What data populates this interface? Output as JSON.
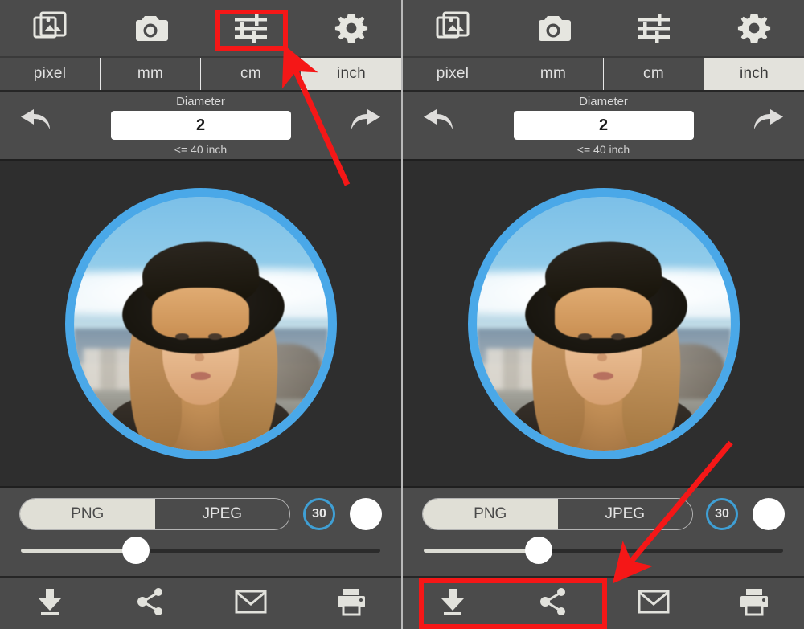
{
  "app": {
    "panels": [
      {
        "id": "left-panel",
        "toolbar": {
          "items": [
            {
              "name": "gallery-icon",
              "label": "Gallery"
            },
            {
              "name": "camera-icon",
              "label": "Camera"
            },
            {
              "name": "adjust-sliders-icon",
              "label": "Adjust"
            },
            {
              "name": "settings-gear-icon",
              "label": "Settings"
            }
          ]
        },
        "unit_tabs": [
          {
            "label": "pixel",
            "active": false
          },
          {
            "label": "mm",
            "active": false
          },
          {
            "label": "cm",
            "active": false
          },
          {
            "label": "inch",
            "active": true
          }
        ],
        "diameter": {
          "label": "Diameter",
          "value": "2",
          "hint": "<= 40 inch",
          "undo_icon": "undo-arrow-icon",
          "redo_icon": "redo-arrow-icon"
        },
        "export": {
          "formats": [
            {
              "label": "PNG",
              "active": true
            },
            {
              "label": "JPEG",
              "active": false
            }
          ],
          "quality_badge": "30",
          "color_swatch": "#ffffff",
          "slider_percent": "32"
        },
        "actions": [
          {
            "name": "download-icon",
            "label": "Download"
          },
          {
            "name": "share-icon",
            "label": "Share"
          },
          {
            "name": "email-icon",
            "label": "Email"
          },
          {
            "name": "print-icon",
            "label": "Print"
          }
        ],
        "annotations": {
          "highlight": "adjust-sliders-icon",
          "arrow": "points-to-adjust-sliders-icon"
        }
      },
      {
        "id": "right-panel",
        "toolbar": {
          "items": [
            {
              "name": "gallery-icon",
              "label": "Gallery"
            },
            {
              "name": "camera-icon",
              "label": "Camera"
            },
            {
              "name": "adjust-sliders-icon",
              "label": "Adjust"
            },
            {
              "name": "settings-gear-icon",
              "label": "Settings"
            }
          ]
        },
        "unit_tabs": [
          {
            "label": "pixel",
            "active": false
          },
          {
            "label": "mm",
            "active": false
          },
          {
            "label": "cm",
            "active": false
          },
          {
            "label": "inch",
            "active": true
          }
        ],
        "diameter": {
          "label": "Diameter",
          "value": "2",
          "hint": "<= 40 inch",
          "undo_icon": "undo-arrow-icon",
          "redo_icon": "redo-arrow-icon"
        },
        "export": {
          "formats": [
            {
              "label": "PNG",
              "active": true
            },
            {
              "label": "JPEG",
              "active": false
            }
          ],
          "quality_badge": "30",
          "color_swatch": "#ffffff",
          "slider_percent": "32"
        },
        "actions": [
          {
            "name": "download-icon",
            "label": "Download"
          },
          {
            "name": "share-icon",
            "label": "Share"
          },
          {
            "name": "email-icon",
            "label": "Email"
          },
          {
            "name": "print-icon",
            "label": "Print"
          }
        ],
        "annotations": {
          "highlight": "download-and-share-icons",
          "arrow": "points-to-download-and-share-icons"
        }
      }
    ],
    "preview": {
      "crop_shape": "circle",
      "ring_color": "#4aa8e8",
      "photo_description": "portrait of a blonde woman wearing a black wide-brim hat"
    },
    "colors": {
      "toolbar_bg": "#4b4b4b",
      "canvas_bg": "#2e2e2e",
      "accent_blue": "#4aa8e8",
      "badge_blue": "#3f9fd4",
      "tab_active_bg": "#e3e2dc",
      "annotation_red": "#f51717"
    }
  }
}
